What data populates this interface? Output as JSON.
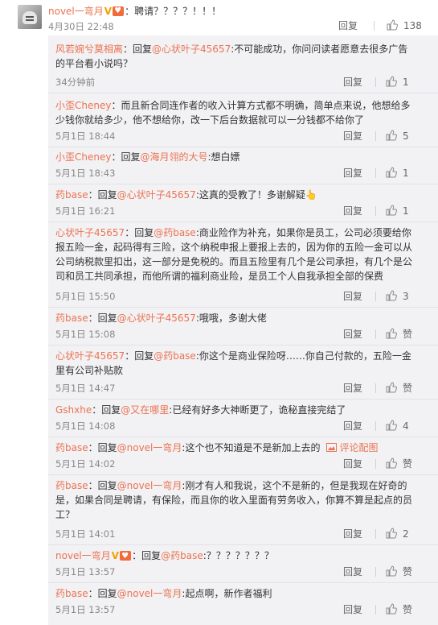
{
  "main_comment": {
    "user": "novel一弯月",
    "badge_v": "V",
    "text": "：聘请？？？？！！！",
    "time": "4月30日 22:48",
    "reply_label": "回复",
    "likes": "138"
  },
  "replies": [
    {
      "user": "风若婉兮莫相离",
      "mid1": "：回复",
      "mention": "@心状叶子45657",
      "text": ":不可能成功，你问问读者愿意去很多广告的平台看小说吗？",
      "time": "34分钟前",
      "reply_label": "回复",
      "likes": "1"
    },
    {
      "user": "小歪Cheney",
      "text": "：而且新合同连作者的收入计算方式都不明确，简单点来说，他想给多少钱你就给多少，他不想给你，改一下后台数据就可以一分钱都不给你了",
      "time": "5月1日 18:44",
      "reply_label": "回复",
      "likes": "5"
    },
    {
      "user": "小歪Cheney",
      "mid1": "：回复",
      "mention": "@海月翎的大号",
      "text": ":想白嫖",
      "time": "5月1日 18:43",
      "reply_label": "回复",
      "likes": "1"
    },
    {
      "user": "药base",
      "mid1": "：回复",
      "mention": "@心状叶子45657",
      "text": ":这真的受教了！多谢解疑👆",
      "time": "5月1日 16:21",
      "reply_label": "回复",
      "likes": "1"
    },
    {
      "user": "心状叶子45657",
      "mid1": "：回复",
      "mention": "@药base",
      "text": ":商业险作为补充，如果你是员工，公司必须要给你报五险一金，起码得有三险，这个纳税申报上要报上去的，因为你的五险一金可以从公司纳税款里扣出，这一部分是免税的。而且五险里有几个是公司承担，有几个是公司和员工共同承担，而他所谓的福利商业险，是员工个人自我承担全部的保费",
      "time": "5月1日 15:50",
      "reply_label": "回复",
      "likes": "3"
    },
    {
      "user": "药base",
      "mid1": "：回复",
      "mention": "@心状叶子45657",
      "text": ":哦哦，多谢大佬",
      "time": "5月1日 15:08",
      "reply_label": "回复",
      "likes": "赞"
    },
    {
      "user": "心状叶子45657",
      "mid1": "：回复",
      "mention": "@药base",
      "text": ":你这个是商业保险呀……你自己付款的，五险一金里有公司补贴款",
      "time": "5月1日 14:47",
      "reply_label": "回复",
      "likes": "赞"
    },
    {
      "user": "Gshxhe",
      "mid1": "：回复",
      "mention": "@又在哪里",
      "text": ":已经有好多大神断更了，诡秘直接完结了",
      "time": "5月1日 14:08",
      "reply_label": "回复",
      "likes": "4"
    },
    {
      "user": "药base",
      "mid1": "：回复",
      "mention": "@novel一弯月",
      "text": ":这个也不知道是不是新加上去的",
      "pic_link": "评论配图",
      "time": "5月1日 14:02",
      "reply_label": "回复",
      "likes": "赞"
    },
    {
      "user": "药base",
      "mid1": "：回复",
      "mention": "@novel一弯月",
      "text": ":刚才有人和我说，这个不是新的，但是我现在好奇的是，如果合同是聘请，有保险，而且你的收入里面有劳务收入，你算不算是起点的员工？",
      "time": "5月1日 14:01",
      "reply_label": "回复",
      "likes": "2"
    },
    {
      "user": "novel一弯月",
      "badge_v": "V",
      "mid1": "：回复",
      "mention": "@药base",
      "text": ":？？？？？？？",
      "time": "5月1日 13:57",
      "reply_label": "回复",
      "likes": "赞"
    },
    {
      "user": "药base",
      "mid1": "：回复",
      "mention": "@novel一弯月",
      "text": ":起点啊，新作者福利",
      "time": "5月1日 13:57",
      "reply_label": "回复",
      "likes": "赞"
    }
  ],
  "icons": {
    "like": "thumbs-up-icon",
    "image": "image-icon",
    "vip": "vip-heart-badge-icon",
    "verified": "verified-v-badge-icon",
    "avatar": "cat-avatar"
  },
  "colors": {
    "username": "#eb7350",
    "panel_bg": "#f2f2f5",
    "text": "#333333",
    "meta": "#888888",
    "vbadge": "#f4a100"
  }
}
